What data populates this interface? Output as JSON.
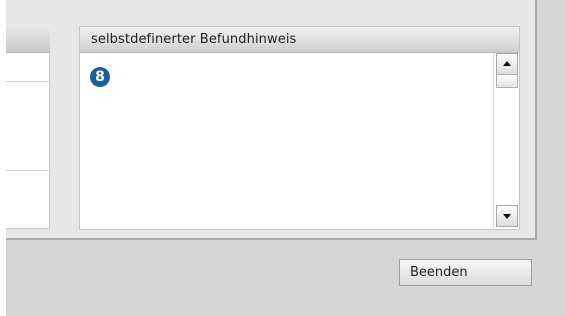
{
  "note_panel": {
    "title": "selbstdefinerter Befundhinweis",
    "badge": "8"
  },
  "scrollbar": {
    "up_icon": "triangle-up",
    "down_icon": "triangle-down"
  },
  "actions": {
    "close_label": "Beenden"
  },
  "colors": {
    "badge": "#1a5f99"
  }
}
